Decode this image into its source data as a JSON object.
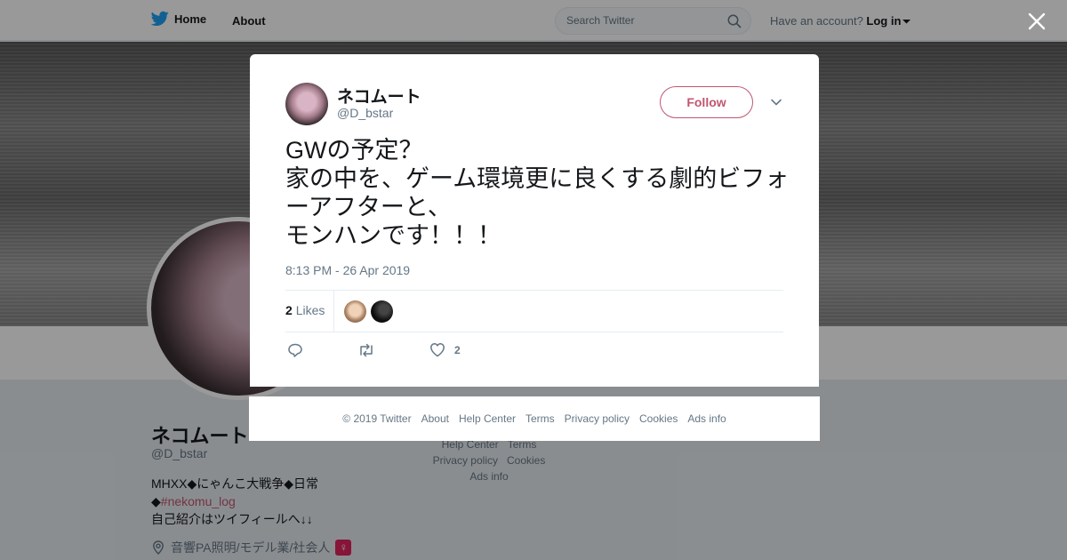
{
  "nav": {
    "home_label": "Home",
    "about_label": "About",
    "search_placeholder": "Search Twitter",
    "account_prompt": "Have an account?",
    "login_label": "Log in"
  },
  "profile": {
    "name": "ネコムート",
    "handle": "@D_bstar",
    "bio_line1": "MHXX◆にゃんこ大戦争◆日常",
    "bio_tag_prefix": "◆",
    "bio_tag": "#nekomu_log",
    "bio_line3": "自己紹介はツイフィールへ↓↓",
    "location": "音響PA照明/モデル業/社会人",
    "gender_badge": "♀",
    "footer_links": [
      "Help Center",
      "Terms",
      "Privacy policy",
      "Cookies",
      "Ads info"
    ]
  },
  "tweet": {
    "author_name": "ネコムート",
    "author_handle": "@D_bstar",
    "follow_label": "Follow",
    "text": "GWの予定？\n家の中を、ゲーム環境更に良くする劇的ビフォーアフターと、\nモンハンです！！！",
    "timestamp": "8:13 PM - 26 Apr 2019",
    "likes_count": "2",
    "likes_label": "Likes",
    "action_like_count": "2"
  },
  "footer": {
    "copyright": "© 2019 Twitter",
    "links": [
      "About",
      "Help Center",
      "Terms",
      "Privacy policy",
      "Cookies",
      "Ads info"
    ]
  },
  "colors": {
    "brand_blue": "#1da1f2",
    "accent_pink": "#c0566f",
    "muted_text": "#657786",
    "overlay": "rgba(0,0,0,0.40)"
  },
  "icons": [
    "twitter-bird-icon",
    "search-icon",
    "caret-down-icon",
    "close-icon",
    "chevron-down-icon",
    "location-pin-icon",
    "reply-icon",
    "retweet-icon",
    "heart-icon"
  ]
}
